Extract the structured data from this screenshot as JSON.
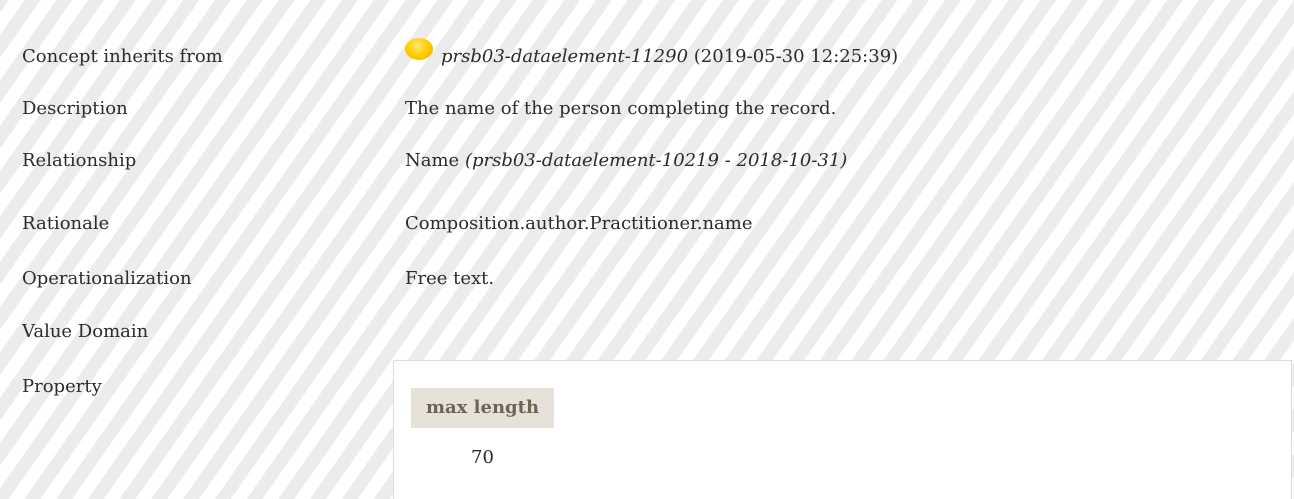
{
  "rows": {
    "inherits": {
      "label": "Concept inherits from",
      "ref_id": "prsb03-dataelement-11290",
      "ref_date": "(2019-05-30 12:25:39)",
      "status_color": "#ffd000"
    },
    "description": {
      "label": "Description",
      "value": "The name of the person completing the record."
    },
    "relationship": {
      "label": "Relationship",
      "name": "Name",
      "ref": "(prsb03-dataelement-10219 - 2018-10-31)"
    },
    "rationale": {
      "label": "Rationale",
      "value": "Composition.author.Practitioner.name"
    },
    "operationalization": {
      "label": "Operationalization",
      "value": "Free text."
    },
    "value_domain": {
      "label": "Value Domain"
    },
    "property": {
      "label": "Property",
      "header": "max length",
      "value": "70"
    }
  }
}
